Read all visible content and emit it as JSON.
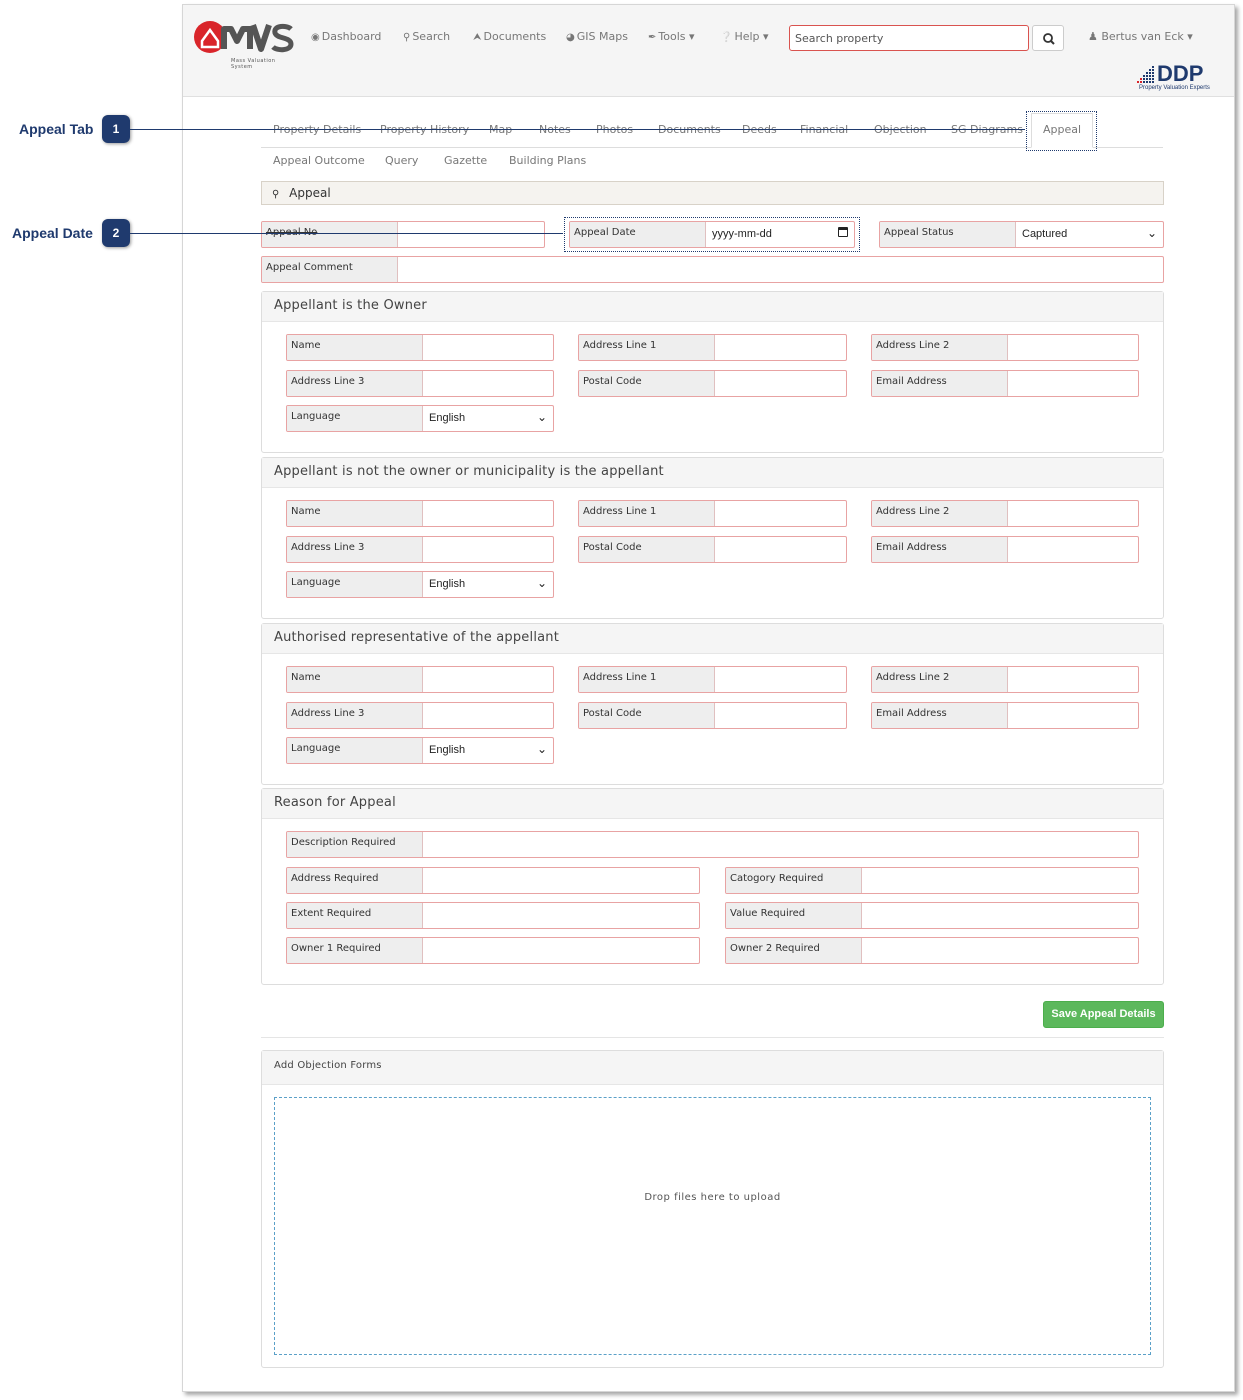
{
  "brand": {
    "logo_text": "MVS",
    "logo_tagline": "Mass Valuation System",
    "partner": "DDP",
    "partner_tagline": "Property Valuation Experts"
  },
  "nav": {
    "items": [
      {
        "label": "Dashboard",
        "icon": "dashboard-icon"
      },
      {
        "label": "Search",
        "icon": "search-icon"
      },
      {
        "label": "Documents",
        "icon": "upload-icon"
      },
      {
        "label": "GIS Maps",
        "icon": "globe-icon"
      },
      {
        "label": "Tools",
        "icon": "wrench-icon"
      },
      {
        "label": "Help",
        "icon": "question-icon"
      }
    ],
    "search_placeholder": "Search property",
    "user": "Bertus van Eck"
  },
  "tabs": {
    "row1": [
      "Property Details",
      "Property History",
      "Map",
      "Notes",
      "Photos",
      "Documents",
      "Deeds",
      "Financial",
      "Objection",
      "SG Diagrams",
      "Appeal"
    ],
    "row2": [
      "Appeal Outcome",
      "Query",
      "Gazette",
      "Building Plans"
    ],
    "active": "Appeal"
  },
  "section_title": "Appeal",
  "appeal": {
    "no_label": "Appeal No",
    "date_label": "Appeal Date",
    "date_placeholder": "yyyy-mm-dd",
    "status_label": "Appeal Status",
    "status_value": "Captured",
    "comment_label": "Appeal Comment"
  },
  "party_fields": {
    "name": "Name",
    "addr1": "Address Line 1",
    "addr2": "Address Line 2",
    "addr3": "Address Line 3",
    "postal": "Postal Code",
    "email": "Email Address",
    "language": "Language",
    "language_value": "English"
  },
  "panels": {
    "owner": "Appellant is the Owner",
    "not_owner": "Appellant is not the owner or municipality is the appellant",
    "rep": "Authorised representative of the appellant",
    "reason": "Reason for Appeal",
    "objection_forms": "Add Objection Forms"
  },
  "reason_fields": {
    "description": "Description Required",
    "address": "Address Required",
    "category": "Catogory Required",
    "extent": "Extent Required",
    "value": "Value Required",
    "owner1": "Owner 1 Required",
    "owner2": "Owner 2 Required"
  },
  "save_label": "Save Appeal Details",
  "dropzone_text": "Drop files here to upload",
  "callouts": [
    {
      "label": "Appeal Tab",
      "number": "1"
    },
    {
      "label": "Appeal Date",
      "number": "2"
    }
  ],
  "colors": {
    "accent": "#1f3a6e",
    "save": "#5cb85c",
    "field_border": "#e8a3a3",
    "logo_red": "#d9252a"
  }
}
